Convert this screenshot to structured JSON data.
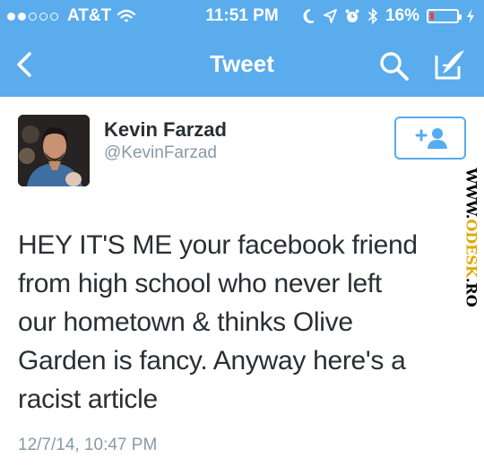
{
  "status_bar": {
    "carrier": "AT&T",
    "time": "11:51 PM",
    "battery_percent": "16%",
    "battery_level": 0.16,
    "signal_bars_filled": 2,
    "signal_bars_total": 5
  },
  "nav": {
    "title": "Tweet",
    "icons": [
      "back-chevron-icon",
      "search-icon",
      "compose-icon"
    ]
  },
  "tweet": {
    "author_name": "Kevin Farzad",
    "author_handle": "@KevinFarzad",
    "lines": [
      "HEY IT'S ME your facebook friend",
      "from high school who never left",
      "our hometown & thinks Olive",
      "Garden is fancy. Anyway here's a",
      "racist article"
    ],
    "timestamp": "12/7/14, 10:47 PM"
  },
  "follow_button": {
    "icon": "add-user-icon"
  },
  "watermark": {
    "prefix": "WWW.",
    "accent": "ODESK",
    "suffix": ".RO"
  },
  "colors": {
    "brand": "#5aacec",
    "text": "#292f33",
    "muted": "#8899a6",
    "battery_low": "#ff3b30"
  }
}
